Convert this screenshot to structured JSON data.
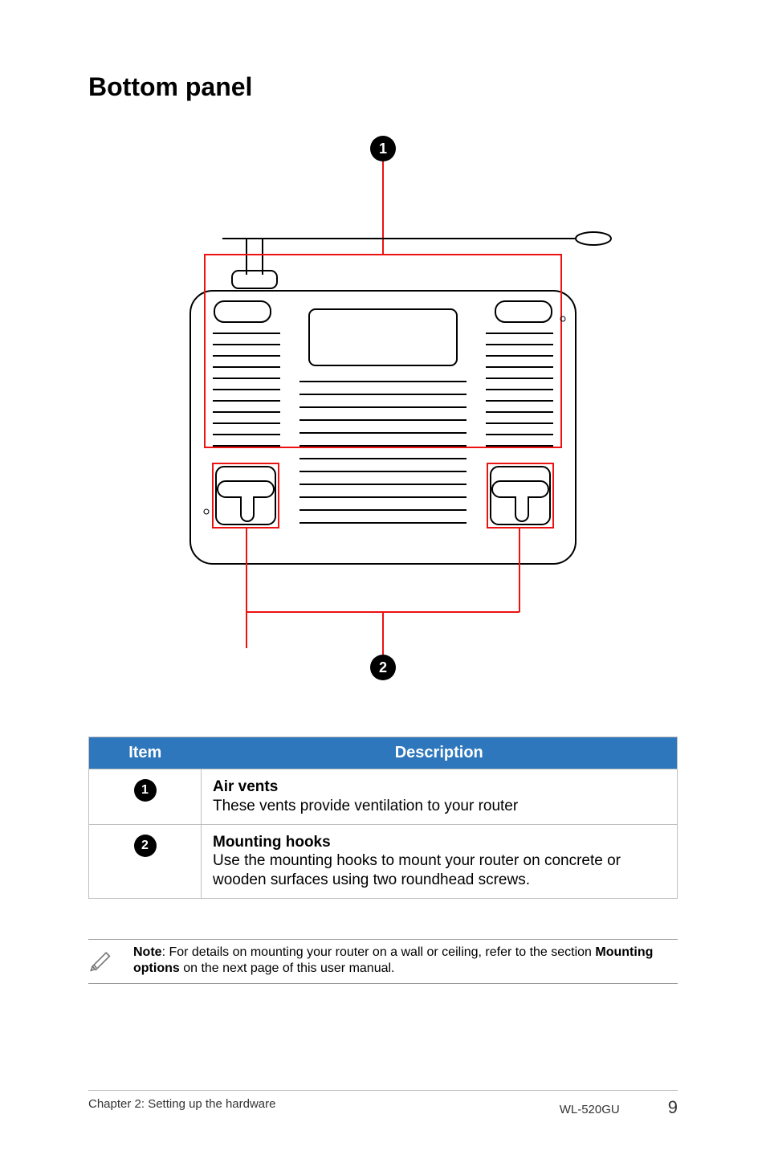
{
  "title": "Bottom panel",
  "callouts": {
    "one": "1",
    "two": "2"
  },
  "table": {
    "headers": {
      "item": "Item",
      "description": "Description"
    },
    "rows": [
      {
        "badge": "1",
        "title": "Air vents",
        "body": "These vents provide ventilation to your router"
      },
      {
        "badge": "2",
        "title": "Mounting hooks",
        "body": "Use the mounting hooks to mount your router on concrete or wooden surfaces using two roundhead screws."
      }
    ]
  },
  "note": {
    "label": "Note",
    "pre": ": For details on mounting your router on a wall or ceiling, refer to the section ",
    "bold": "Mounting options",
    "post": " on the next page of this user manual."
  },
  "footer": {
    "left": "Chapter 2: Setting up the hardware",
    "model": "WL-520GU",
    "page": "9"
  }
}
